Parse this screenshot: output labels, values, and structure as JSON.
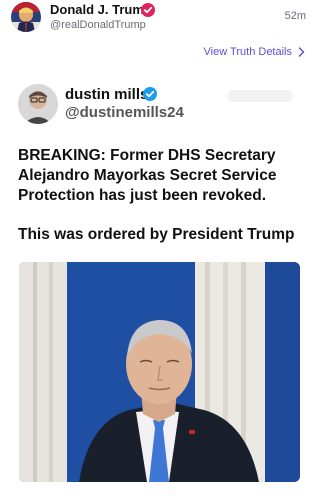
{
  "post": {
    "author_name": "Donald J. Trump",
    "author_handle": "@realDonaldTrump",
    "time": "52m",
    "details_link": "View Truth Details"
  },
  "quoted": {
    "author_name": "dustin mills",
    "author_handle": "@dustinemills24",
    "text_lines": [
      "BREAKING: Former DHS Secretary Alejandro Mayorkas Secret Service Protection has just been revoked.",
      "This was ordered by President Trump"
    ]
  },
  "colors": {
    "verified": "#e0245e",
    "verified_blue": "#1d9bf0",
    "link": "#5b52d6",
    "photo_background": "#1f4fa3"
  }
}
